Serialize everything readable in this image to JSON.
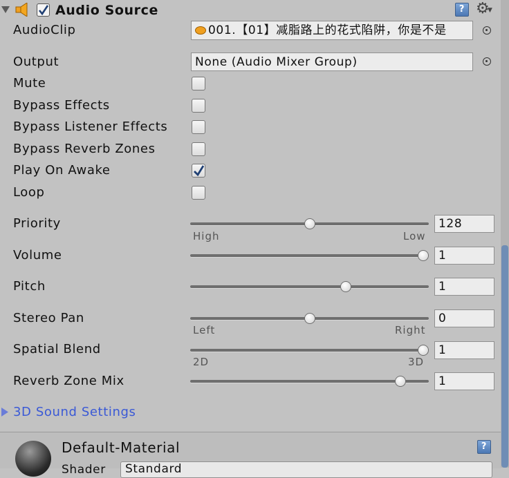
{
  "header": {
    "title": "Audio Source",
    "enabled": true,
    "icons": [
      "foldout-arrow-icon",
      "speaker-icon",
      "help-book-icon",
      "gear-icon"
    ]
  },
  "fields": {
    "audioclip": {
      "label": "AudioClip",
      "value": "001.【01】减脂路上的花式陷阱，你是不是"
    },
    "output": {
      "label": "Output",
      "value": "None (Audio Mixer Group)"
    }
  },
  "toggles": [
    {
      "label": "Mute",
      "checked": false
    },
    {
      "label": "Bypass Effects",
      "checked": false
    },
    {
      "label": "Bypass Listener Effects",
      "checked": false
    },
    {
      "label": "Bypass Reverb Zones",
      "checked": false
    },
    {
      "label": "Play On Awake",
      "checked": true
    },
    {
      "label": "Loop",
      "checked": false
    }
  ],
  "sliders": {
    "priority": {
      "label": "Priority",
      "value": "128",
      "min_label": "High",
      "max_label": "Low",
      "fraction": 0.5
    },
    "volume": {
      "label": "Volume",
      "value": "1",
      "fraction": 1.0
    },
    "pitch": {
      "label": "Pitch",
      "value": "1",
      "fraction": 0.66
    },
    "stereo_pan": {
      "label": "Stereo Pan",
      "value": "0",
      "min_label": "Left",
      "max_label": "Right",
      "fraction": 0.5
    },
    "spatial_blend": {
      "label": "Spatial Blend",
      "value": "1",
      "min_label": "2D",
      "max_label": "3D",
      "fraction": 1.0
    },
    "reverb_zone_mix": {
      "label": "Reverb Zone Mix",
      "value": "1",
      "fraction": 0.9
    }
  },
  "sound3d": {
    "label": "3D Sound Settings"
  },
  "material": {
    "name": "Default-Material",
    "shader_label": "Shader",
    "shader_value": "Standard"
  },
  "colors": {
    "accent_link": "#3a59d6",
    "scroll_thumb": "#6f8db5",
    "check": "#1f3f73"
  }
}
